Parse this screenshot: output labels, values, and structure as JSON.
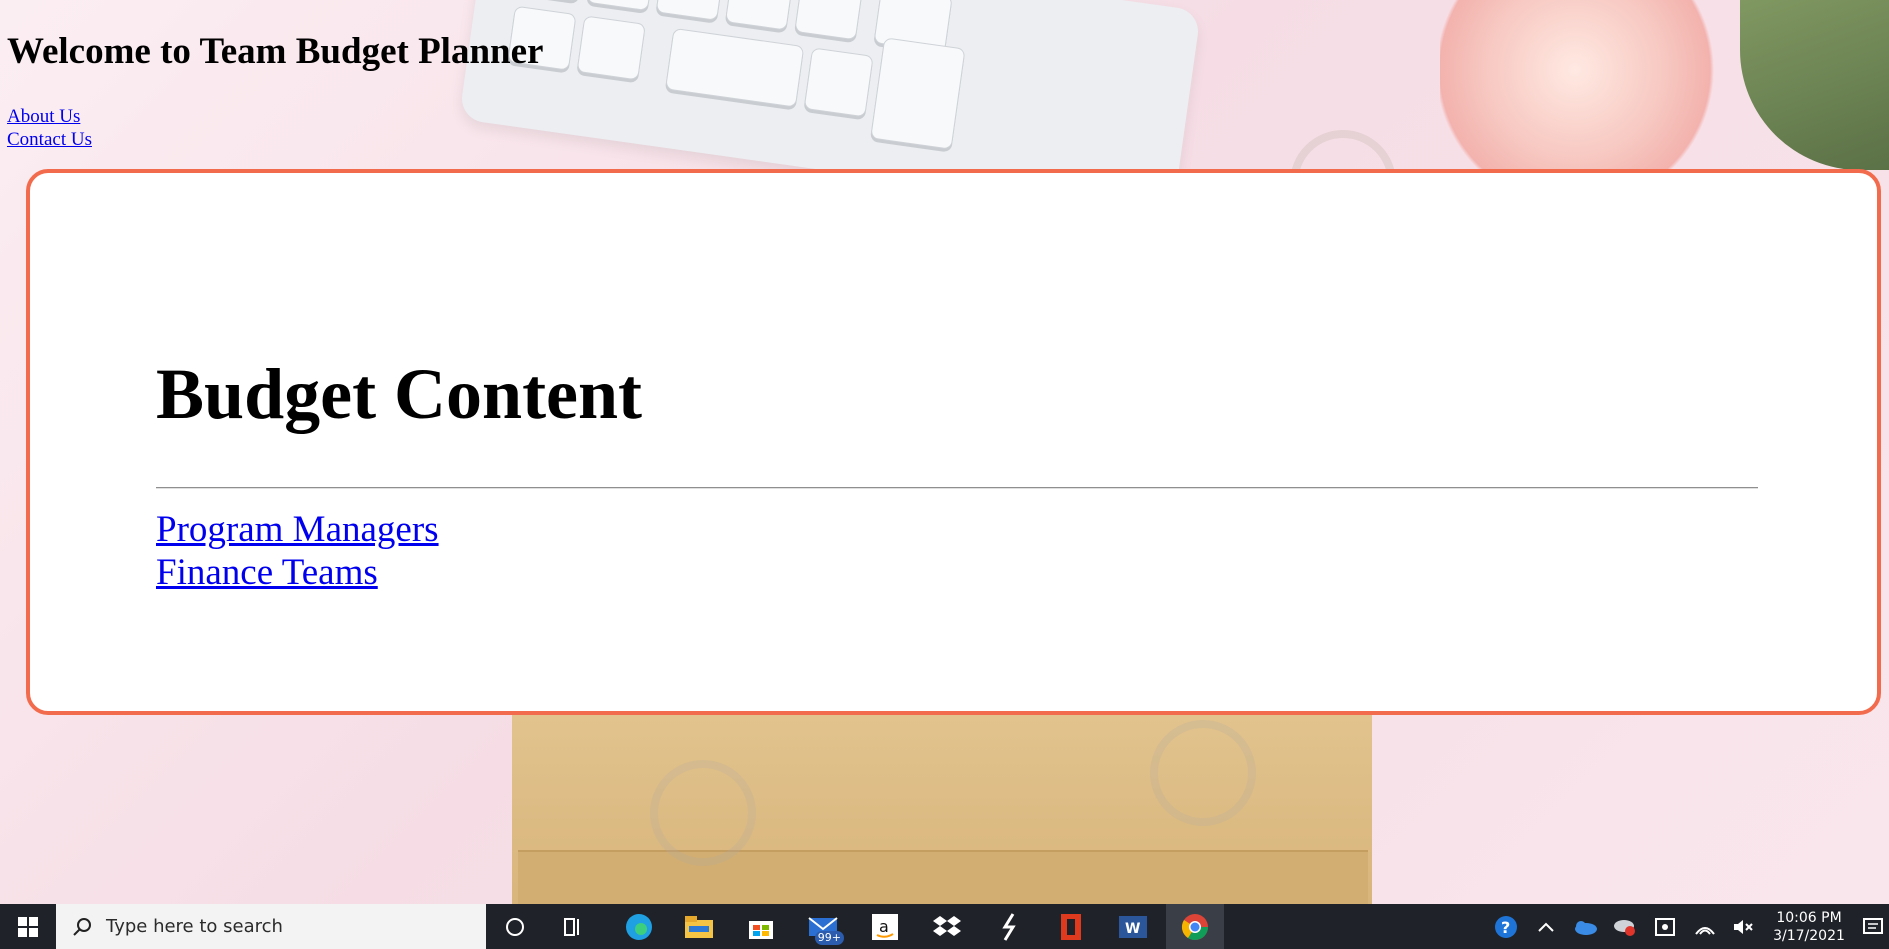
{
  "page": {
    "header_title": "Welcome to Team Budget Planner",
    "nav": [
      {
        "label": "About Us"
      },
      {
        "label": "Contact Us"
      }
    ]
  },
  "card": {
    "heading": "Budget Content",
    "links": [
      {
        "label": "Program Managers"
      },
      {
        "label": "Finance Teams"
      }
    ],
    "border_color": "#f26b4c"
  },
  "taskbar": {
    "search_placeholder": "Type here to search",
    "pinned_apps": [
      {
        "name": "cortana-icon"
      },
      {
        "name": "task-view-icon"
      },
      {
        "name": "edge-icon"
      },
      {
        "name": "file-explorer-icon"
      },
      {
        "name": "store-icon"
      },
      {
        "name": "mail-icon",
        "badge": "99+"
      },
      {
        "name": "amazon-icon"
      },
      {
        "name": "dropbox-icon"
      },
      {
        "name": "app-icon"
      },
      {
        "name": "office-icon"
      },
      {
        "name": "word-icon"
      },
      {
        "name": "chrome-icon"
      }
    ],
    "clock": {
      "time": "10:06 PM",
      "date": "3/17/2021"
    }
  }
}
